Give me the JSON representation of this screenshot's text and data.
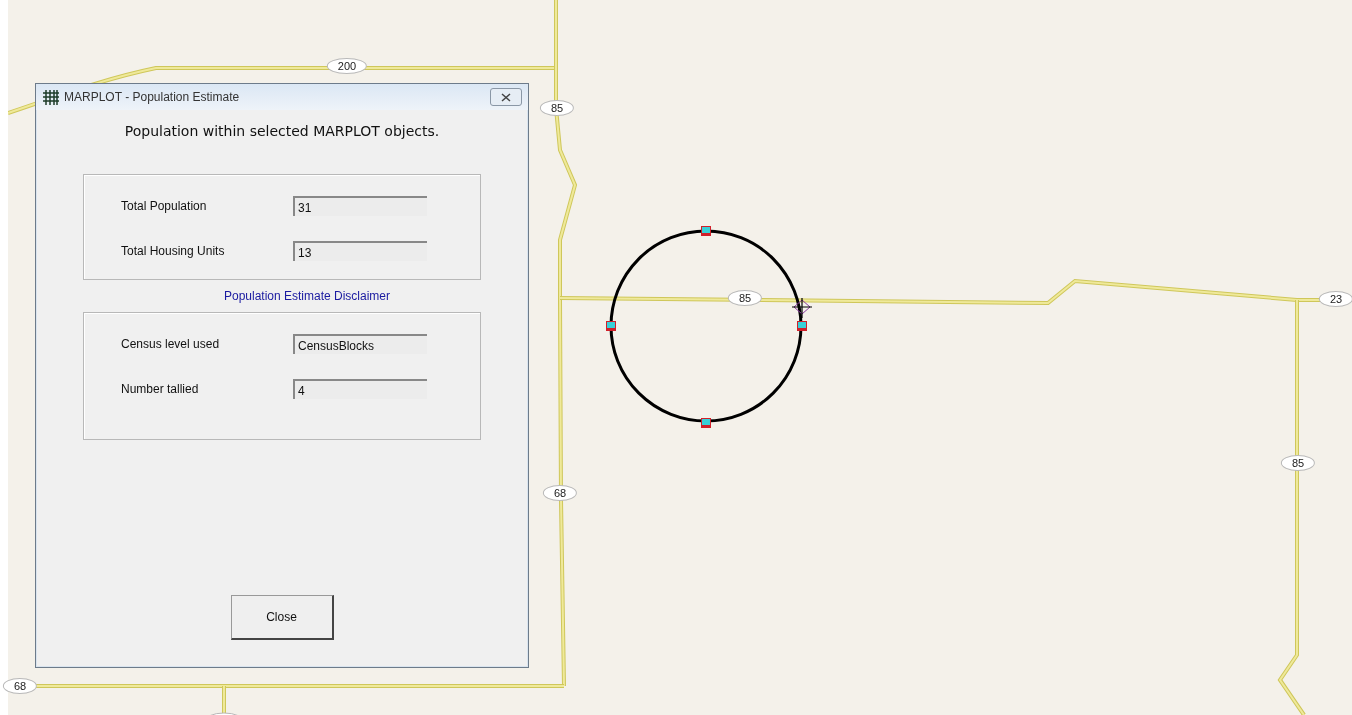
{
  "map": {
    "road_labels": [
      {
        "text": "200"
      },
      {
        "text": "85"
      },
      {
        "text": "85"
      },
      {
        "text": "68"
      },
      {
        "text": "68"
      },
      {
        "text": "23"
      },
      {
        "text": "85"
      }
    ]
  },
  "dialog": {
    "title": "MARPLOT - Population Estimate",
    "heading": "Population within selected MARPLOT objects.",
    "totals": [
      {
        "label": "Total Population",
        "value": "31"
      },
      {
        "label": "Total Housing Units",
        "value": "13"
      }
    ],
    "disclaimer_link": "Population Estimate Disclaimer",
    "details": [
      {
        "label": "Census level used",
        "value": "CensusBlocks"
      },
      {
        "label": "Number tallied",
        "value": "4"
      }
    ],
    "close_button": "Close"
  }
}
